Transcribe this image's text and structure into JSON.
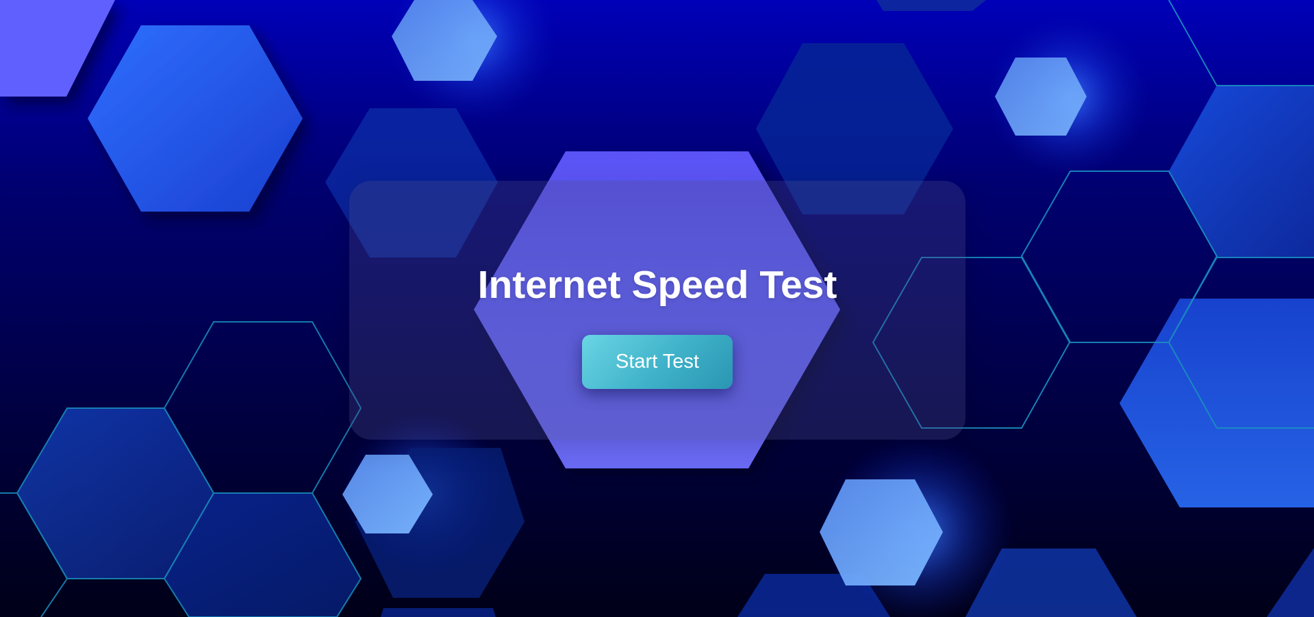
{
  "page": {
    "title": "Internet Speed Test",
    "start_button_label": "Start Test"
  },
  "colors": {
    "background_top": "#0000b8",
    "background_bottom": "#000018",
    "center_hexagon": "#6363ff",
    "button_start": "#6ad5e4",
    "button_end": "#2a95b2",
    "outline_stroke": "#1a8fc0",
    "text": "#ffffff"
  },
  "icons": [
    "hexagon-pattern-background"
  ]
}
